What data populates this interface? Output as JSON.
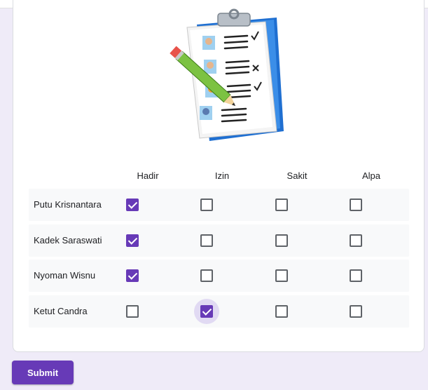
{
  "form": {
    "illustration_icon": "clipboard-attendance-checklist-icon",
    "columns": [
      "Hadir",
      "Izin",
      "Sakit",
      "Alpa"
    ],
    "rows": [
      {
        "name": "Putu Krisnantara",
        "checked": [
          true,
          false,
          false,
          false
        ]
      },
      {
        "name": "Kadek Saraswati",
        "checked": [
          true,
          false,
          false,
          false
        ]
      },
      {
        "name": "Nyoman Wisnu",
        "checked": [
          true,
          false,
          false,
          false
        ]
      },
      {
        "name": "Ketut Candra",
        "checked": [
          false,
          true,
          false,
          false
        ]
      }
    ],
    "focused_cell": {
      "row": 3,
      "column": 1
    },
    "submit_label": "Submit",
    "colors": {
      "accent": "#673ab7",
      "background": "#efebf8",
      "row_bg": "#f8f9fa",
      "focus_halo": "#e1daf3"
    }
  }
}
